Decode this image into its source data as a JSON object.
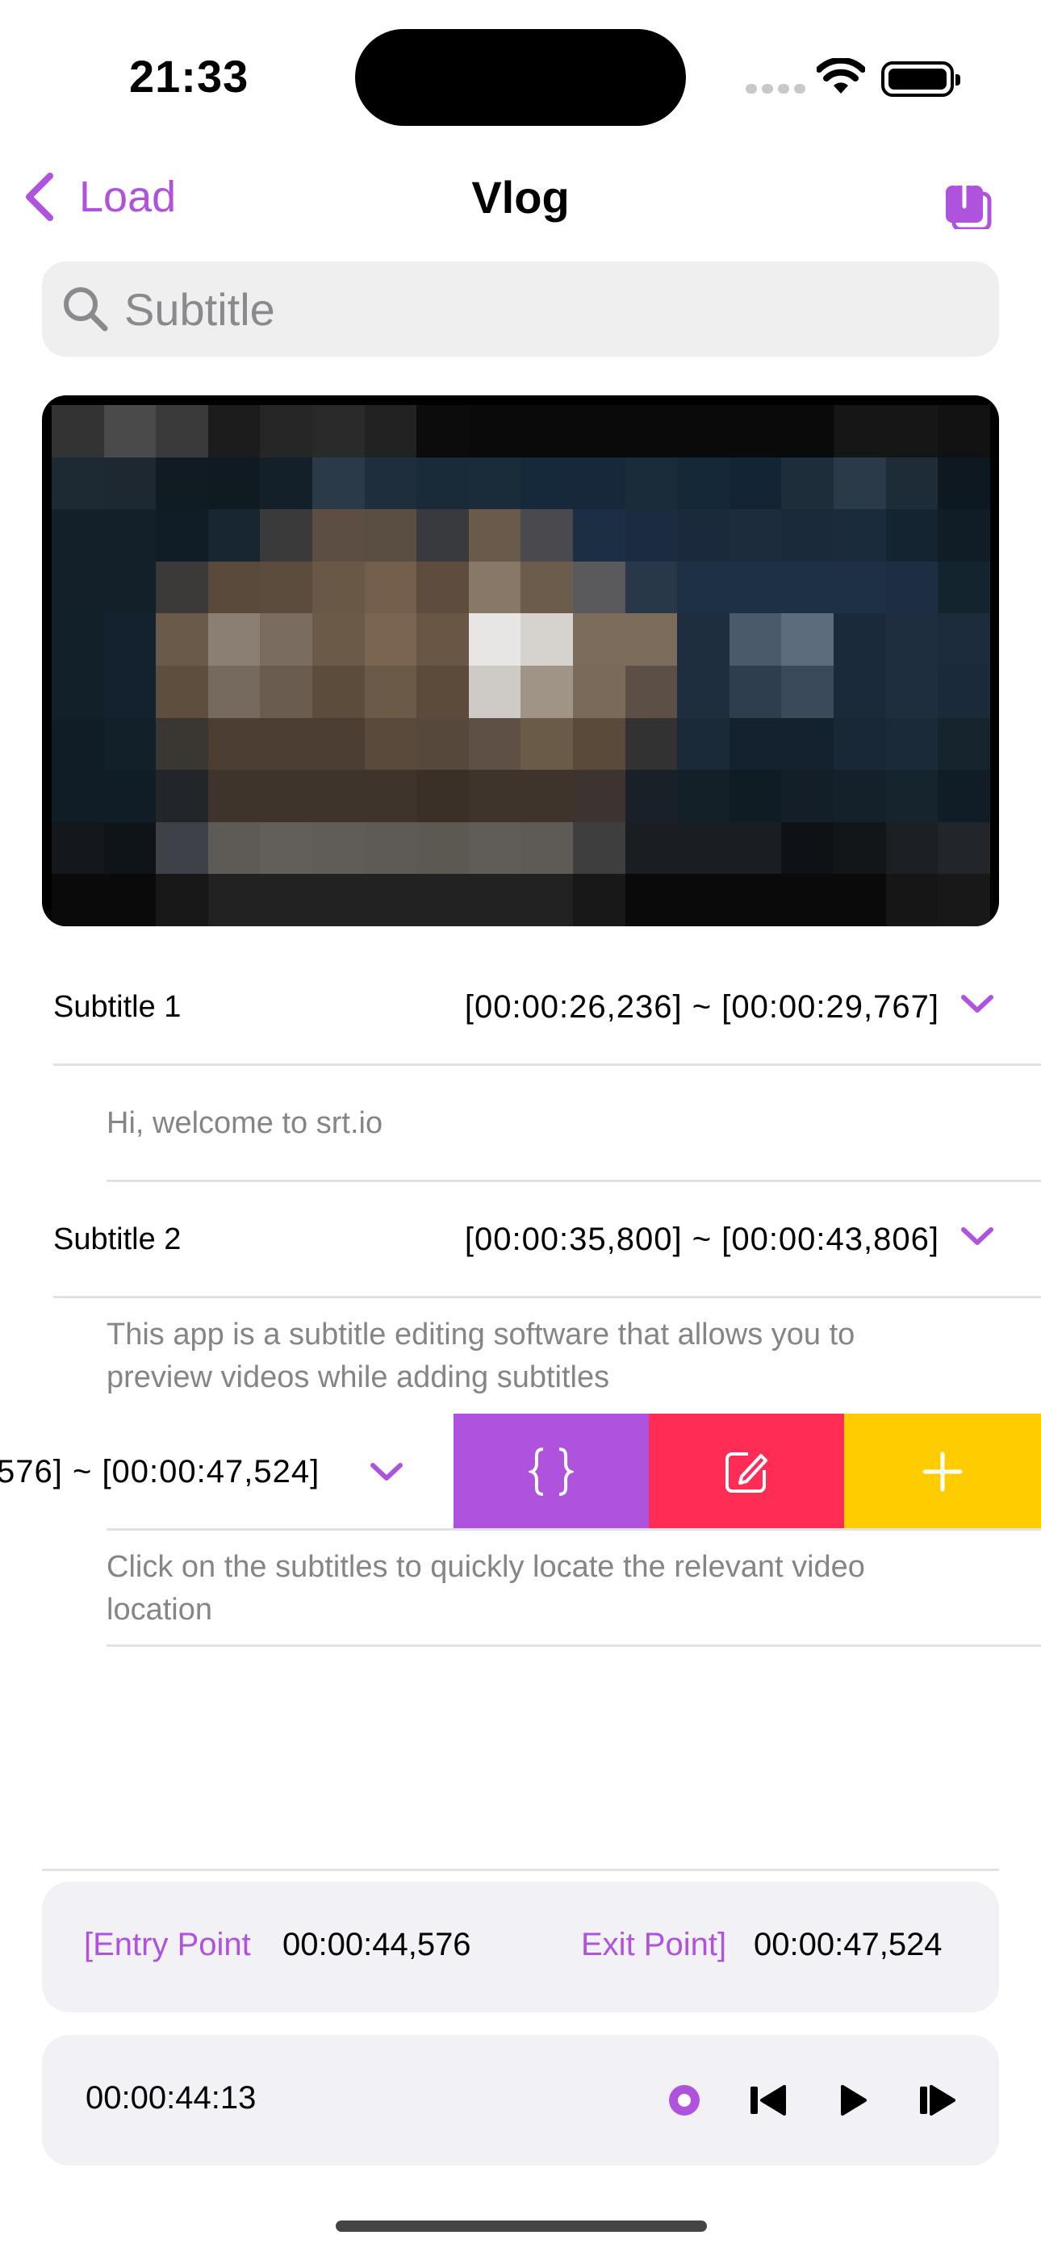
{
  "status_bar": {
    "time": "21:33"
  },
  "nav": {
    "back_label": "Load",
    "title": "Vlog"
  },
  "search": {
    "placeholder": "Subtitle"
  },
  "subtitles": [
    {
      "name": "Subtitle 1",
      "time": "[00:00:26,236]  ~  [00:00:29,767]",
      "text": "Hi, welcome to srt.io"
    },
    {
      "name": "Subtitle 2",
      "time": "[00:00:35,800]  ~  [00:00:43,806]",
      "text": "This app is a subtitle editing software that allows you to preview videos while adding subtitles"
    },
    {
      "time_partial": "576]  ~  [00:00:47,524]",
      "text": "Click on the subtitles to quickly locate the relevant video location"
    }
  ],
  "swipe_actions": {
    "brace_color": "#af52de",
    "edit_color": "#ff2d55",
    "add_color": "#ffcc00"
  },
  "points": {
    "entry_label": "[Entry Point",
    "entry_value": "00:00:44,576",
    "exit_label": "Exit Point]",
    "exit_value": "00:00:47,524"
  },
  "player": {
    "current_time": "00:00:44:13"
  },
  "colors": {
    "accent": "#af52de"
  }
}
